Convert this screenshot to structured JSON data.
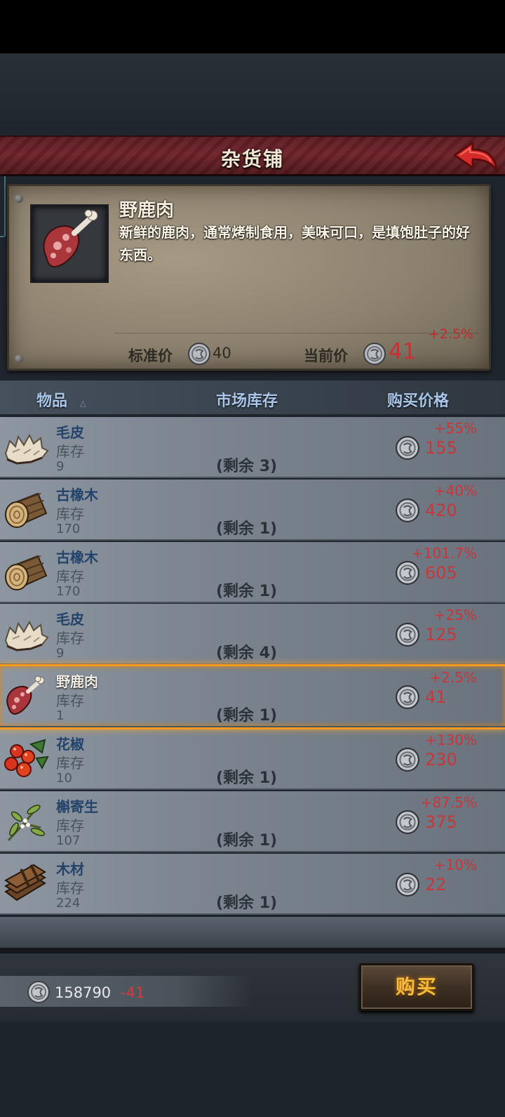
{
  "header": {
    "title": "杂货铺"
  },
  "detail": {
    "name": "野鹿肉",
    "description": "新鲜的鹿肉，通常烤制食用，美味可口，是填饱肚子的好东西。",
    "std_label": "标准价",
    "std_price": "40",
    "cur_label": "当前价",
    "cur_price": "41",
    "change": "+2.5%",
    "icon": "venison-icon"
  },
  "columns": {
    "item": "物品",
    "stock": "市场库存",
    "price": "购买价格"
  },
  "items": [
    {
      "name": "毛皮",
      "stock_label": "库存",
      "stock": "9",
      "remaining": "(剩余 3)",
      "change": "+55%",
      "price": "155",
      "icon": "fur-icon"
    },
    {
      "name": "古橡木",
      "stock_label": "库存",
      "stock": "170",
      "remaining": "(剩余 1)",
      "change": "+40%",
      "price": "420",
      "icon": "oak-log-icon"
    },
    {
      "name": "古橡木",
      "stock_label": "库存",
      "stock": "170",
      "remaining": "(剩余 1)",
      "change": "+101.7%",
      "price": "605",
      "icon": "oak-log-icon"
    },
    {
      "name": "毛皮",
      "stock_label": "库存",
      "stock": "9",
      "remaining": "(剩余 4)",
      "change": "+25%",
      "price": "125",
      "icon": "fur-icon"
    },
    {
      "name": "野鹿肉",
      "stock_label": "库存",
      "stock": "1",
      "remaining": "(剩余 1)",
      "change": "+2.5%",
      "price": "41",
      "icon": "venison-icon",
      "selected": true
    },
    {
      "name": "花椒",
      "stock_label": "库存",
      "stock": "10",
      "remaining": "(剩余 1)",
      "change": "+130%",
      "price": "230",
      "icon": "pepper-berries-icon"
    },
    {
      "name": "槲寄生",
      "stock_label": "库存",
      "stock": "107",
      "remaining": "(剩余 1)",
      "change": "+87.5%",
      "price": "375",
      "icon": "mistletoe-icon"
    },
    {
      "name": "木材",
      "stock_label": "库存",
      "stock": "224",
      "remaining": "(剩余 1)",
      "change": "+10%",
      "price": "22",
      "icon": "lumber-icon"
    }
  ],
  "footer": {
    "money": "158790",
    "delta": "-41",
    "buy_label": "购买"
  },
  "colors": {
    "accent_red": "#c8363a",
    "selection": "#f29a21",
    "header": "#6e2329",
    "buy_text": "#f5bb3c"
  }
}
